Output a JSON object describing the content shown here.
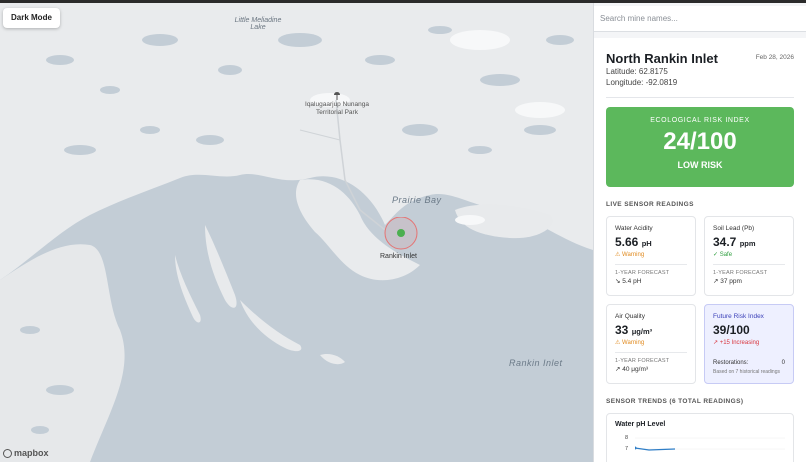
{
  "map": {
    "dark_mode_label": "Dark Mode",
    "labels": {
      "lake": "Little Meliadine\nLake",
      "park": "Iqalugaarjup Nunanga\nTerritorial Park",
      "prairie_bay": "Prairie Bay",
      "rankin_inlet_water": "Rankin Inlet",
      "rankin_inlet_place": "Rankin Inlet"
    },
    "attribution": "mapbox",
    "marker_color": "#4caf50"
  },
  "sidebar": {
    "search_placeholder": "Search mine names...",
    "mine": {
      "name": "North Rankin Inlet",
      "date": "Feb 28, 2026",
      "latitude": "Latitude: 62.8175",
      "longitude": "Longitude: -92.0819"
    },
    "risk": {
      "title": "ECOLOGICAL RISK INDEX",
      "score": "24/100",
      "level": "LOW RISK",
      "color": "#5cb85c"
    },
    "live_title": "LIVE SENSOR READINGS",
    "sensors": {
      "water": {
        "label": "Water Acidity",
        "value": "5.66",
        "unit": "pH",
        "status": "⚠ Warning",
        "fc_label": "1-YEAR FORECAST",
        "fc_value": "↘ 5.4 pH"
      },
      "lead": {
        "label": "Soil Lead (Pb)",
        "value": "34.7",
        "unit": "ppm",
        "status": "✓ Safe",
        "fc_label": "1-YEAR FORECAST",
        "fc_value": "↗ 37 ppm"
      },
      "air": {
        "label": "Air Quality",
        "value": "33",
        "unit": "μg/m³",
        "status": "⚠ Warning",
        "fc_label": "1-YEAR FORECAST",
        "fc_value": "↗ 40 μg/m³"
      },
      "future": {
        "label": "Future Risk Index",
        "value": "39/100",
        "status": "↗ +15 Increasing",
        "resto_label": "Restorations:",
        "resto_value": "0",
        "note": "Based on 7 historical readings"
      }
    },
    "trends_title": "SENSOR TRENDS (6 TOTAL READINGS)",
    "trend_chart": {
      "title": "Water pH Level",
      "ticks": [
        "8",
        "7"
      ]
    }
  }
}
